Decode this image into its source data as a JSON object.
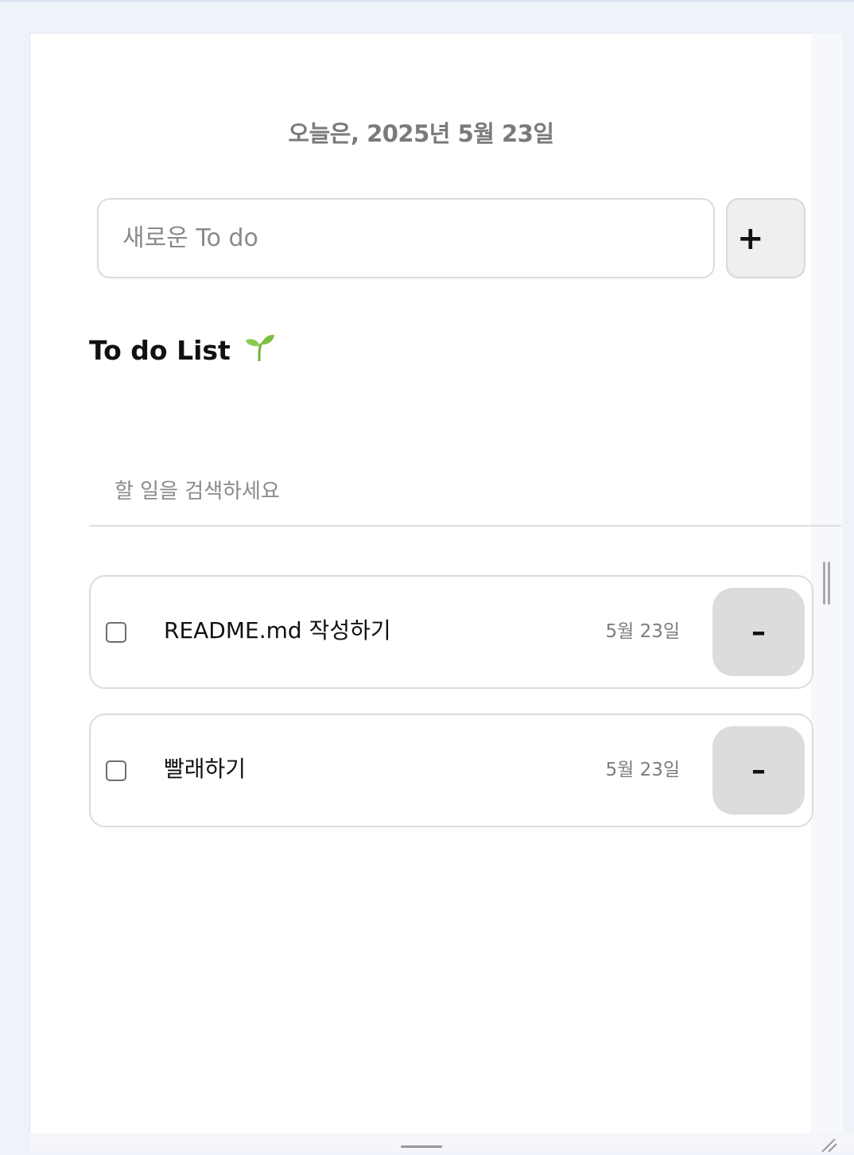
{
  "header": {
    "date_heading": "오늘은, 2025년 5월 23일"
  },
  "new_todo": {
    "placeholder": "새로운 To do",
    "add_label": "+"
  },
  "list": {
    "title": "To do List",
    "title_emoji_icon": "sprout-icon",
    "search_placeholder": "할 일을 검색하세요",
    "items": [
      {
        "text": "README.md 작성하기",
        "date": "5월 23일",
        "done": false,
        "remove_label": "–"
      },
      {
        "text": "빨래하기",
        "date": "5월 23일",
        "done": false,
        "remove_label": "–"
      }
    ]
  },
  "colors": {
    "page_background": "#eef2f9",
    "card_background": "#ffffff",
    "border": "#dcdcdc",
    "button_gray": "#dcdcdc",
    "muted_text": "#7c7c7c",
    "sprout_green": "#7cc142"
  }
}
